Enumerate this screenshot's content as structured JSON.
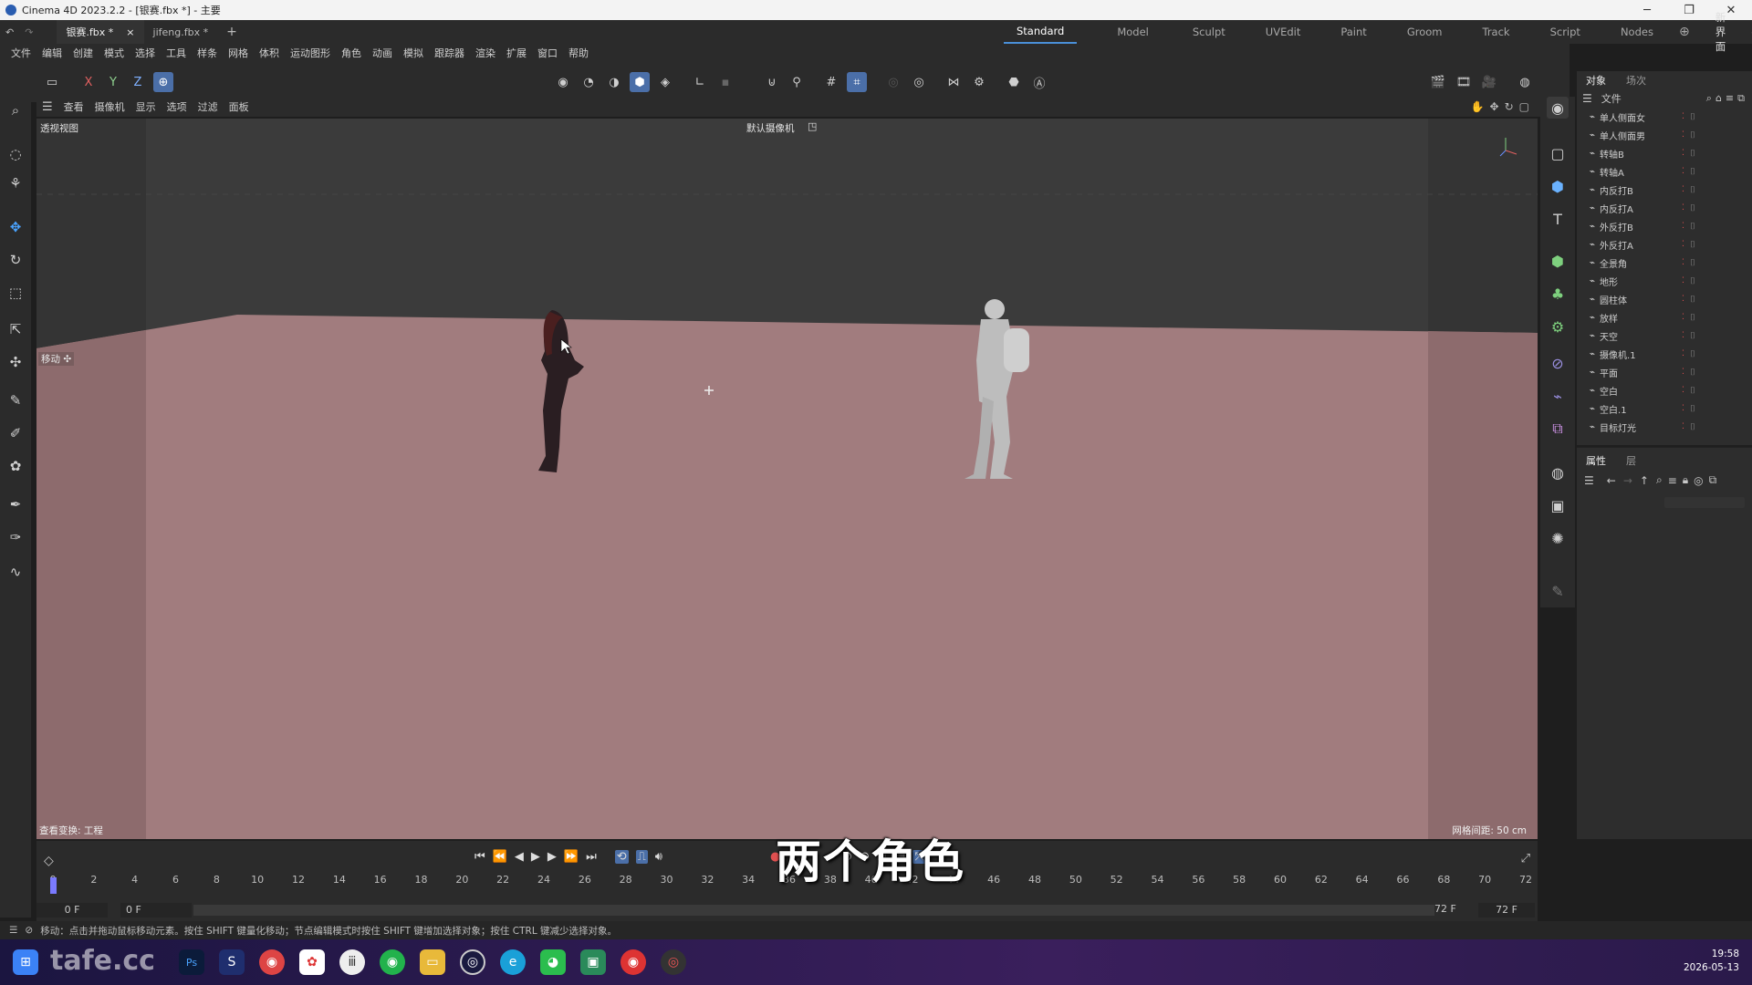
{
  "window": {
    "title": "Cinema 4D 2023.2.2 - [银赛.fbx *] - 主要",
    "controls": [
      "─",
      "❐",
      "✕"
    ]
  },
  "doc_tabs": [
    {
      "label": "银赛.fbx *",
      "active": true
    },
    {
      "label": "jifeng.fbx *",
      "active": false
    }
  ],
  "doc_tabs_close": "×",
  "doc_tabs_add": "+",
  "layouts": [
    "Standard",
    "Model",
    "Sculpt",
    "UVEdit",
    "Paint",
    "Groom",
    "Track",
    "Script",
    "Nodes"
  ],
  "layout_active": "Standard",
  "new_layout_label": "新界面",
  "menu": [
    "文件",
    "编辑",
    "创建",
    "模式",
    "选择",
    "工具",
    "样条",
    "网格",
    "体积",
    "运动图形",
    "角色",
    "动画",
    "模拟",
    "跟踪器",
    "渲染",
    "扩展",
    "窗口",
    "帮助"
  ],
  "axis_toggles": [
    "X",
    "Y",
    "Z"
  ],
  "viewport_menu": [
    "查看",
    "摄像机",
    "显示",
    "选项",
    "过滤",
    "面板"
  ],
  "viewport": {
    "view_name": "透视视图",
    "camera_label": "默认摄像机",
    "move_hint": "移动 ✣",
    "bottom_left": "查看变换: 工程",
    "bottom_right": "网格间距: 50 cm",
    "colors": {
      "floor": "#a07878",
      "sky": "#3a3a3a"
    }
  },
  "objects_panel": {
    "tabs": [
      "对象",
      "场次"
    ],
    "file_menu": "文件",
    "items": [
      "单人侧面女",
      "单人侧面男",
      "转轴B",
      "转轴A",
      "内反打B",
      "内反打A",
      "外反打B",
      "外反打A",
      "全景角",
      "地形",
      "圆柱体",
      "放样",
      "天空",
      "摄像机.1",
      "平面",
      "空白",
      "空白.1",
      "目标灯光"
    ]
  },
  "attributes_panel": {
    "tabs": [
      "属性",
      "层"
    ]
  },
  "timeline": {
    "ticks": [
      "0",
      "2",
      "4",
      "6",
      "8",
      "10",
      "12",
      "14",
      "16",
      "18",
      "20",
      "22",
      "24",
      "26",
      "28",
      "30",
      "32",
      "34",
      "36",
      "38",
      "40",
      "42",
      "44",
      "46",
      "48",
      "50",
      "52",
      "54",
      "56",
      "58",
      "60",
      "62",
      "64",
      "66",
      "68",
      "70",
      "72"
    ],
    "current_frame": "0 F",
    "start_frame": "0 F",
    "end_frame": "72 F",
    "end_frame_max": "72 F"
  },
  "status_text": "移动：点击并拖动鼠标移动元素。按住 SHIFT 键量化移动；节点编辑模式时按住 SHIFT 键增加选择对象；按住 CTRL 键减少选择对象。",
  "subtitle": "两个角色",
  "watermark": "tafe.cc",
  "taskbar": {
    "time": "19:58",
    "date": "2026-05-13",
    "apps": [
      "windows-start",
      "search",
      "task-view",
      "photoshop",
      "cinema4d-s",
      "chrome",
      "photos",
      "hub",
      "green-app",
      "explorer",
      "c4d",
      "edge",
      "wechat",
      "screen-app",
      "red-app",
      "c4d-red"
    ]
  }
}
